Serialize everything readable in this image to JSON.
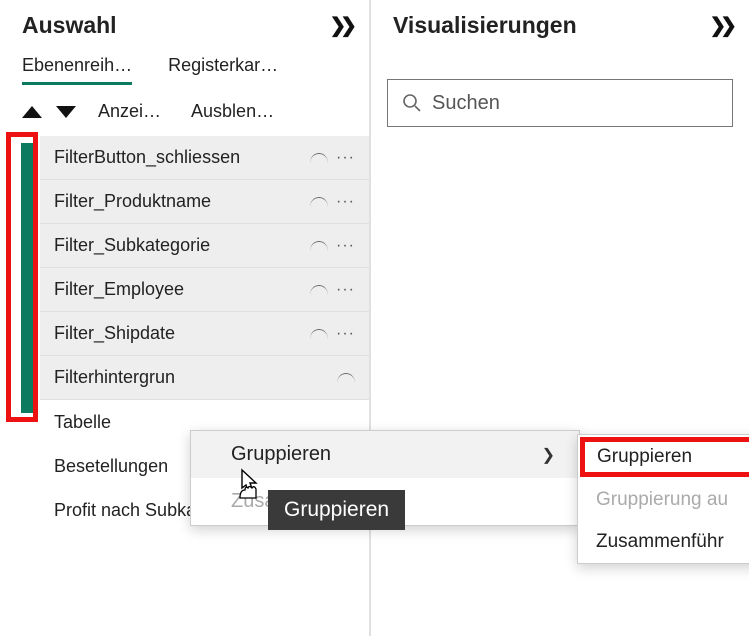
{
  "selection": {
    "title": "Auswahl",
    "tabs": {
      "layer": "Ebenenreih…",
      "tab2": "Registerkar…"
    },
    "toolbar": {
      "show": "Anzei…",
      "hide": "Ausblen…"
    },
    "layers": [
      {
        "name": "FilterButton_schliessen",
        "selected": true
      },
      {
        "name": "Filter_Produktname",
        "selected": true
      },
      {
        "name": "Filter_Subkategorie",
        "selected": true
      },
      {
        "name": "Filter_Employee",
        "selected": true
      },
      {
        "name": "Filter_Shipdate",
        "selected": true
      },
      {
        "name": "Filterhintergrun",
        "selected": true
      },
      {
        "name": "Tabelle",
        "selected": false
      },
      {
        "name": "Besetellungen",
        "selected": false
      },
      {
        "name": "Profit nach Subkateg…",
        "selected": false
      }
    ]
  },
  "viz": {
    "title": "Visualisierungen",
    "search_placeholder": "Suchen"
  },
  "context_menu": {
    "group": "Gruppieren",
    "merge": "Zusa"
  },
  "tooltip": "Gruppieren",
  "submenu": {
    "group": "Gruppieren",
    "ungroup": "Gruppierung au",
    "merge": "Zusammenführ"
  }
}
